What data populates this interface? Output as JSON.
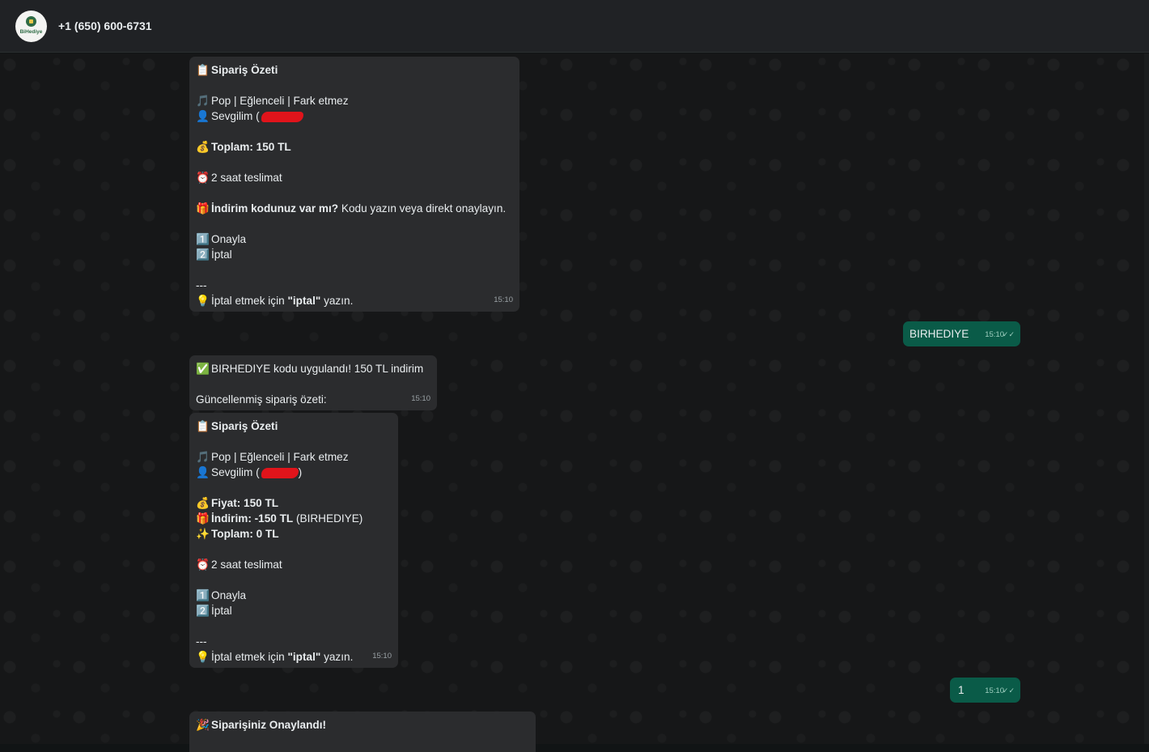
{
  "header": {
    "avatar_text": "BiHediye",
    "contact_name": "+1 (650) 600-6731"
  },
  "messages": {
    "m1": {
      "time": "15:10",
      "title": "Sipariş Özeti",
      "genre": "Pop | Eğlenceli | Fark etmez",
      "recipient": "Sevgilim (",
      "total": "Toplam: 150 TL",
      "delivery": "2 saat teslimat",
      "discount_q_bold": "İndirim kodunuz var mı?",
      "discount_q_rest": " Kodu yazın veya direkt onaylayın.",
      "opt1": "Onayla",
      "opt2": "İptal",
      "sep": "---",
      "cancel_pre": "İptal etmek için ",
      "cancel_bold": "\"iptal\"",
      "cancel_post": " yazın."
    },
    "m2": {
      "text": "BIRHEDIYE",
      "time": "15:10"
    },
    "m3": {
      "line1": "BIRHEDIYE kodu uygulandı! 150 TL indirim",
      "line2": "Güncellenmiş sipariş özeti:",
      "time": "15:10"
    },
    "m4": {
      "time": "15:10",
      "title": "Sipariş Özeti",
      "genre": "Pop | Eğlenceli | Fark etmez",
      "recipient": "Sevgilim (",
      "recipient_close": ")",
      "price": "Fiyat: 150 TL",
      "discount_bold": "İndirim: -150 TL",
      "discount_rest": " (BIRHEDIYE)",
      "total": "Toplam: 0 TL",
      "delivery": "2 saat teslimat",
      "opt1": "Onayla",
      "opt2": "İptal",
      "sep": "---",
      "cancel_pre": "İptal etmek için ",
      "cancel_bold": "\"iptal\"",
      "cancel_post": " yazın."
    },
    "m5": {
      "text": "1",
      "time": "15:10"
    },
    "m6": {
      "title": "Siparişiniz Onaylandı!"
    }
  },
  "icons": {
    "clipboard": "📋",
    "music": "🎵",
    "person": "👤",
    "money": "💰",
    "clock": "⏰",
    "gift": "🎁",
    "one": "1️⃣",
    "two": "2️⃣",
    "bulb": "💡",
    "check": "✅",
    "sparkles": "✨",
    "party": "🎉",
    "read_ticks": "✓✓"
  },
  "colors": {
    "incoming_bubble": "#2b2c2e",
    "outgoing_bubble": "#0a5b48",
    "header_bg": "#202225",
    "redaction": "#e0141b"
  }
}
